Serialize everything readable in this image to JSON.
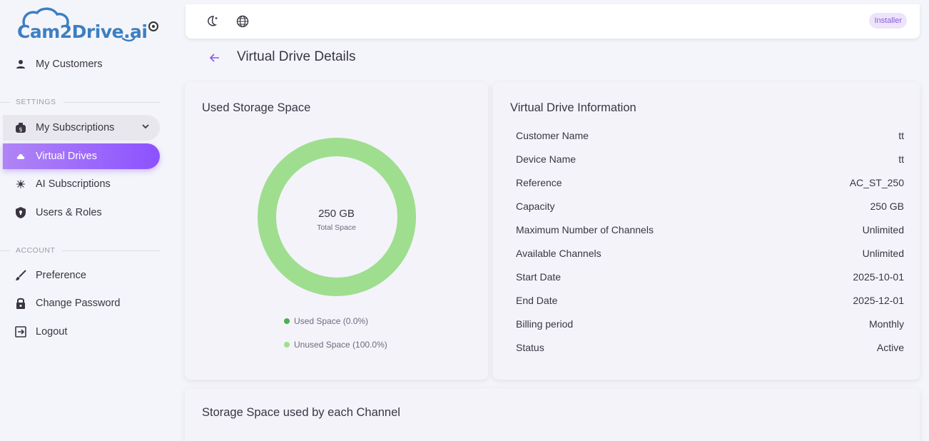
{
  "brand": {
    "logo_text": "Cam2Drive.ai"
  },
  "sidebar": {
    "my_customers": "My Customers",
    "settings_section": "SETTINGS",
    "my_subscriptions": "My Subscriptions",
    "virtual_drives": "Virtual Drives",
    "ai_subscriptions": "AI Subscriptions",
    "users_roles": "Users & Roles",
    "account_section": "ACCOUNT",
    "preference": "Preference",
    "change_password": "Change Password",
    "logout": "Logout"
  },
  "topbar": {
    "role_badge": "Installer",
    "icons": [
      "theme-toggle-icon",
      "language-icon"
    ]
  },
  "page": {
    "title": "Virtual Drive Details"
  },
  "storage_card": {
    "title": "Used Storage Space",
    "total_value": "250 GB",
    "total_label": "Total Space",
    "used_legend": "Used Space (0.0%)",
    "unused_legend": "Unused Space (100.0%)",
    "colors": {
      "used": "#4caf50",
      "unused": "#9fde8f"
    }
  },
  "chart_data": {
    "type": "pie",
    "categories": [
      "Used Space",
      "Unused Space"
    ],
    "values": [
      0.0,
      100.0
    ]
  },
  "info_card": {
    "title": "Virtual Drive Information",
    "rows": [
      {
        "label": "Customer Name",
        "value": "tt"
      },
      {
        "label": "Device Name",
        "value": "tt"
      },
      {
        "label": "Reference",
        "value": "AC_ST_250"
      },
      {
        "label": "Capacity",
        "value": "250 GB"
      },
      {
        "label": "Maximum Number of Channels",
        "value": "Unlimited"
      },
      {
        "label": "Available Channels",
        "value": "Unlimited"
      },
      {
        "label": "Start Date",
        "value": "2025-10-01"
      },
      {
        "label": "End Date",
        "value": "2025-12-01"
      },
      {
        "label": "Billing period",
        "value": "Monthly"
      },
      {
        "label": "Status",
        "value": "Active"
      }
    ]
  },
  "channel_card": {
    "title": "Storage Space used by each Channel"
  },
  "colors": {
    "accent": "#8c52ff",
    "brand": "#3d7fc1"
  }
}
